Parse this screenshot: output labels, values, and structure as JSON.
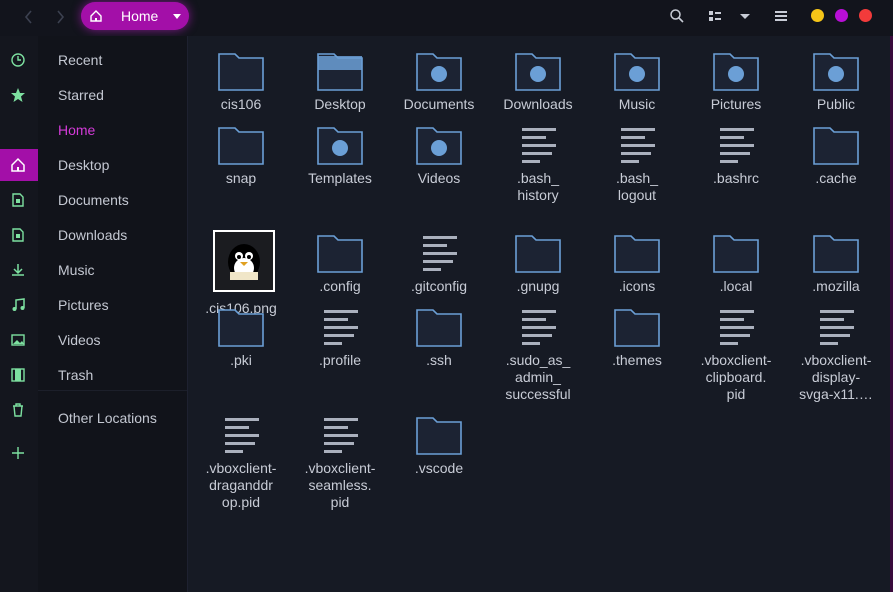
{
  "header": {
    "back_icon": "chevron-left-icon",
    "forward_icon": "chevron-right-icon",
    "path_label": "Home",
    "path_icon": "home-icon",
    "search_icon": "search-icon",
    "view_icon": "grid-view-icon",
    "menu_icon": "hamburger-menu-icon",
    "accent": "#a30fa8",
    "window_buttons": [
      "#f5c518",
      "#b80fd6",
      "#f23b3b"
    ]
  },
  "sidebar": {
    "items": [
      {
        "label": "Recent",
        "icon": "clock-icon"
      },
      {
        "label": "Starred",
        "icon": "star-icon"
      },
      {
        "label": "Home",
        "icon": "home-icon",
        "active": true
      },
      {
        "label": "Desktop",
        "icon": "desktop-icon"
      },
      {
        "label": "Documents",
        "icon": "documents-icon"
      },
      {
        "label": "Downloads",
        "icon": "download-icon"
      },
      {
        "label": "Music",
        "icon": "music-note-icon"
      },
      {
        "label": "Pictures",
        "icon": "picture-icon"
      },
      {
        "label": "Videos",
        "icon": "film-icon"
      },
      {
        "label": "Trash",
        "icon": "trash-icon"
      },
      {
        "label": "Other Locations",
        "icon": "plus-icon"
      }
    ]
  },
  "files": [
    {
      "name": "cis106",
      "type": "folder"
    },
    {
      "name": "Desktop",
      "type": "folder-desktop"
    },
    {
      "name": "Documents",
      "type": "folder-documents"
    },
    {
      "name": "Downloads",
      "type": "folder-downloads"
    },
    {
      "name": "Music",
      "type": "folder-music"
    },
    {
      "name": "Pictures",
      "type": "folder-pictures"
    },
    {
      "name": "Public",
      "type": "folder-public"
    },
    {
      "name": "snap",
      "type": "folder"
    },
    {
      "name": "Templates",
      "type": "folder-templates"
    },
    {
      "name": "Videos",
      "type": "folder-videos"
    },
    {
      "name": ".bash_\nhistory",
      "type": "text"
    },
    {
      "name": ".bash_\nlogout",
      "type": "text"
    },
    {
      "name": ".bashrc",
      "type": "text"
    },
    {
      "name": ".cache",
      "type": "folder"
    },
    {
      "name": ".cis106.png",
      "type": "image"
    },
    {
      "name": ".config",
      "type": "folder"
    },
    {
      "name": ".gitconfig",
      "type": "text"
    },
    {
      "name": ".gnupg",
      "type": "folder"
    },
    {
      "name": ".icons",
      "type": "folder"
    },
    {
      "name": ".local",
      "type": "folder"
    },
    {
      "name": ".mozilla",
      "type": "folder"
    },
    {
      "name": ".pki",
      "type": "folder"
    },
    {
      "name": ".profile",
      "type": "text"
    },
    {
      "name": ".ssh",
      "type": "folder"
    },
    {
      "name": ".sudo_as_\nadmin_\nsuccessful",
      "type": "text"
    },
    {
      "name": ".themes",
      "type": "folder"
    },
    {
      "name": ".vboxclient-\nclipboard.\npid",
      "type": "text"
    },
    {
      "name": ".vboxclient-\ndisplay-\nsvga-x11.…",
      "type": "text"
    },
    {
      "name": ".vboxclient-\ndraganddr\nop.pid",
      "type": "text"
    },
    {
      "name": ".vboxclient-\nseamless.\npid",
      "type": "text"
    },
    {
      "name": ".vscode",
      "type": "folder"
    }
  ]
}
